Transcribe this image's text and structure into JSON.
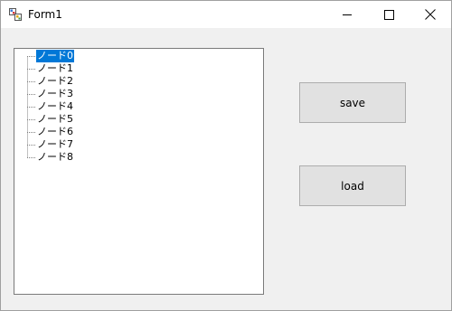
{
  "window": {
    "title": "Form1",
    "icon": "winforms-app-icon",
    "controls": [
      "minimize-icon",
      "maximize-icon",
      "close-icon"
    ]
  },
  "tree": {
    "selected_index": 0,
    "nodes": [
      "ノード0",
      "ノード1",
      "ノード2",
      "ノード3",
      "ノード4",
      "ノード5",
      "ノード6",
      "ノード7",
      "ノード8"
    ]
  },
  "buttons": {
    "save_label": "save",
    "load_label": "load"
  },
  "colors": {
    "selection": "#0078d7",
    "button_face": "#e1e1e1",
    "form_background": "#f0f0f0"
  }
}
